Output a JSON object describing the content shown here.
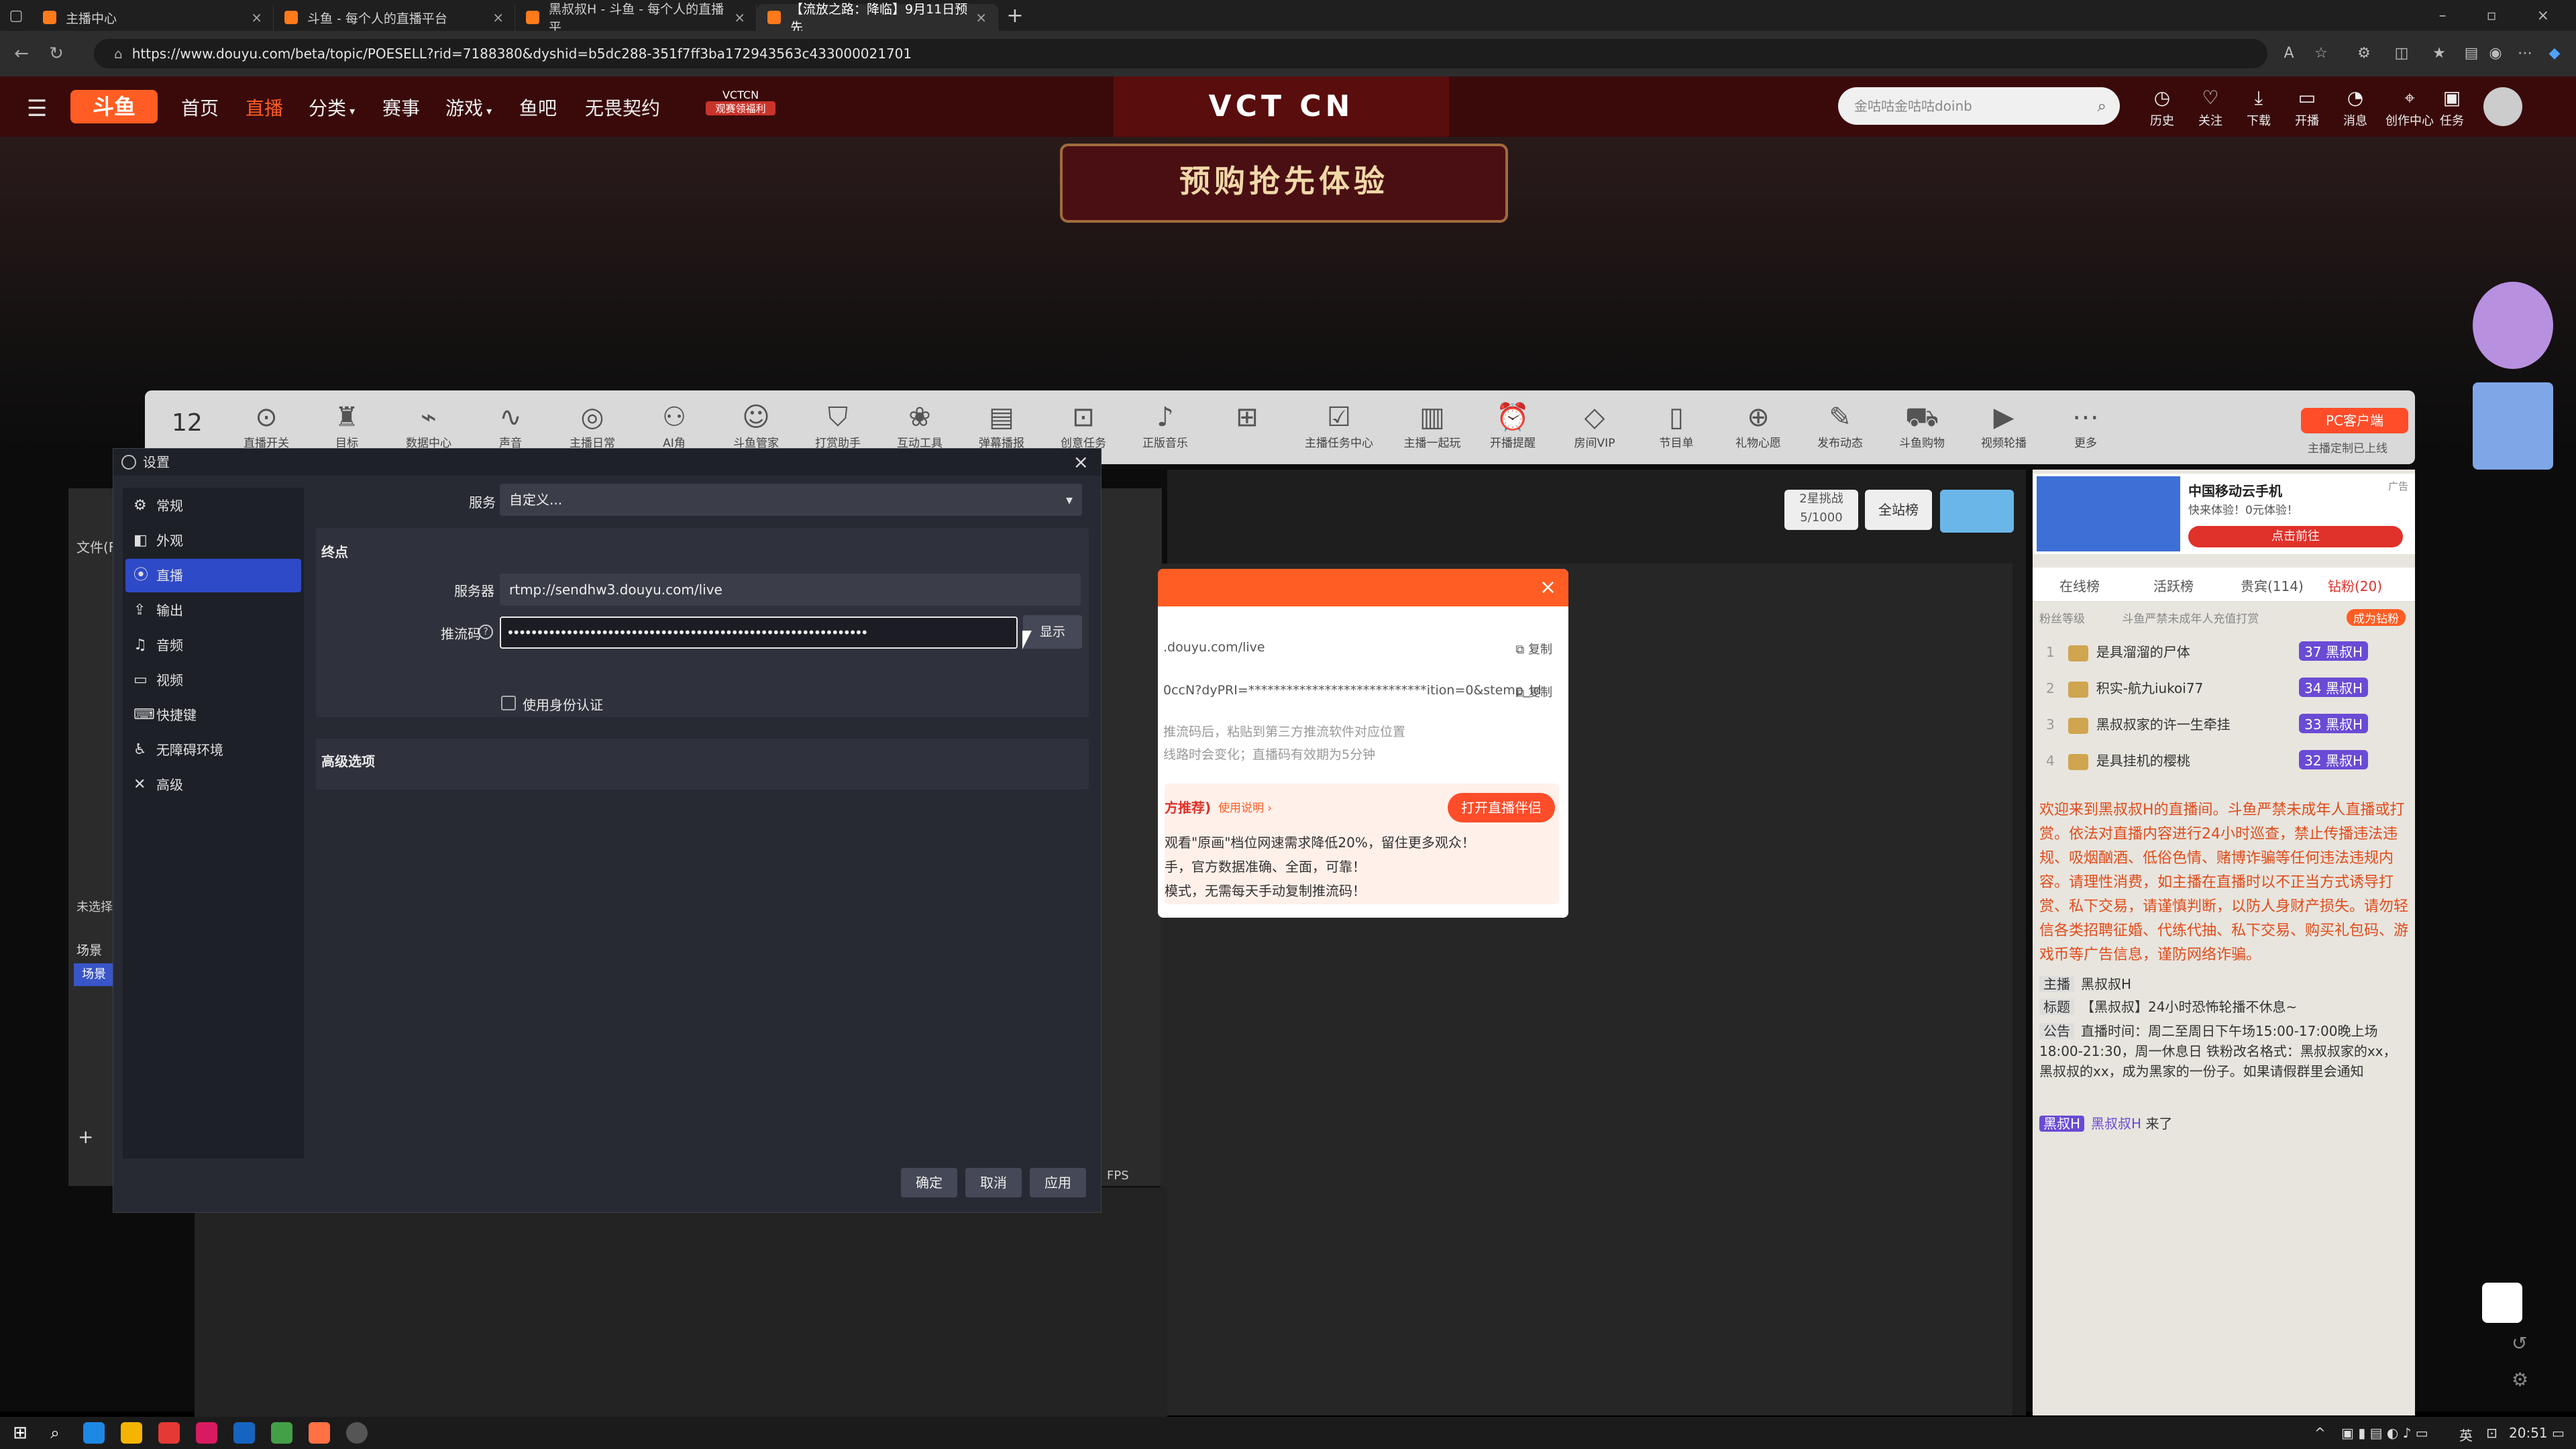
{
  "browser": {
    "tabs": [
      {
        "label": "主播中心"
      },
      {
        "label": "斗鱼 - 每个人的直播平台"
      },
      {
        "label": "黑叔叔H - 斗鱼 - 每个人的直播平"
      },
      {
        "label": "【流放之路：降临】9月11日预先"
      }
    ],
    "url": "https://www.douyu.com/beta/topic/POESELL?rid=7188380&dyshid=b5dc288-351f7ff3ba172943563c433000021701"
  },
  "site": {
    "logo": "斗鱼",
    "nav": [
      "首页",
      "直播",
      "分类",
      "赛事",
      "游戏",
      "鱼吧",
      "无畏契约"
    ],
    "vct_small": "VCTCN",
    "vct_sub": "观赛领福利",
    "vct_banner": "VCT CN",
    "search_placeholder": "金咕咕金咕咕doinb",
    "header_icons": [
      {
        "icon": "history-icon",
        "label": "历史"
      },
      {
        "icon": "heart-icon",
        "label": "关注"
      },
      {
        "icon": "download-icon",
        "label": "下载"
      },
      {
        "icon": "broadcast-icon",
        "label": "开播"
      },
      {
        "icon": "bell-icon",
        "label": "消息"
      },
      {
        "icon": "creator-icon",
        "label": "创作中心"
      },
      {
        "icon": "task-icon",
        "label": "任务"
      }
    ]
  },
  "hero": {
    "presale": "预购抢先体验"
  },
  "toolstrip": {
    "count": "12",
    "items": [
      "直播开关",
      "目标",
      "数据中心",
      "声音",
      "主播日常",
      "AI角",
      "斗鱼管家",
      "打赏助手",
      "互动工具",
      "弹幕播报",
      "创意任务",
      "正版音乐",
      "",
      "主播任务中心",
      "主播一起玩",
      "开播提醒",
      "房间VIP",
      "节目单",
      "礼物心愿",
      "发布动态",
      "斗鱼购物",
      "视频轮播",
      "更多"
    ],
    "pc_client": "PC客户端",
    "pc_client_sub": "主播定制已上线"
  },
  "room": {
    "challenge": "2星挑战",
    "challenge_progress": "5/1000",
    "all_station": "全站榜",
    "ad_title": "中国移动云手机",
    "ad_sub": "快来体验！0元体验！",
    "ad_btn": "点击前往",
    "ad_tag": "广告",
    "rank_tabs": [
      "在线榜",
      "活跃榜",
      "贵宾(114)",
      "钻粉(20)"
    ],
    "fan_level": "粉丝等级",
    "fan_note": "斗鱼严禁未成年人充值打赏",
    "fan_join": "成为钻粉",
    "rank_list": [
      {
        "rank": "1",
        "name": "是具溜溜的尸体",
        "level": "37",
        "badge": "黑叔H"
      },
      {
        "rank": "2",
        "name": "积实-航九iukoi77",
        "level": "34",
        "badge": "黑叔H"
      },
      {
        "rank": "3",
        "name": "黑叔叔家的许一生牵挂",
        "level": "33",
        "badge": "黑叔H"
      },
      {
        "rank": "4",
        "name": "是具挂机的樱桃",
        "level": "32",
        "badge": "黑叔H"
      }
    ],
    "welcome": "欢迎来到黑叔叔H的直播间。斗鱼严禁未成年人直播或打赏。依法对直播内容进行24小时巡查，禁止传播违法违规、吸烟酗酒、低俗色情、赌博诈骗等任何违法违规内容。请理性消费，如主播在直播时以不正当方式诱导打赏、私下交易，请谨慎判断，以防人身财产损失。请勿轻信各类招聘征婚、代练代抽、私下交易、购买礼包码、游戏币等广告信息，谨防网络诈骗。",
    "anchor_label": "主播",
    "anchor": "黑叔叔H",
    "title_label": "标题",
    "title": "【黑叔叔】24小时恐怖轮播不休息~",
    "notice_label": "公告",
    "notice": "直播时间：周二至周日下午场15:00-17:00晚上场18:00-21:30，周一休息日 铁粉改名格式：黑叔叔家的xx，黑叔叔的xx，成为黑家的一份子。如果请假群里会通知",
    "join_badge": "黑叔H",
    "join_name": "黑叔叔H",
    "join_text": "来了"
  },
  "dy_modal": {
    "server_url": ".douyu.com/live",
    "key_masked": "0ccN?dyPRI=****************************ition=0&stemp_id",
    "copy": "复制",
    "tip1": "推流码后，粘贴到第三方推流软件对应位置",
    "tip2": "线路时会变化；直播码有效期为5分钟",
    "recommend": "方推荐)",
    "howto": "使用说明 ›",
    "open_btn": "打开直播伴侣",
    "line1": "观看\"原画\"档位网速需求降低20%，留住更多观众！",
    "line2": "手，官方数据准确、全面，可靠！",
    "line3": "模式，无需每天手动复制推流码！"
  },
  "obs": {
    "title": "设置",
    "sidebar": [
      {
        "icon": "gear-icon",
        "label": "常规"
      },
      {
        "icon": "appearance-icon",
        "label": "外观"
      },
      {
        "icon": "stream-icon",
        "label": "直播"
      },
      {
        "icon": "output-icon",
        "label": "输出"
      },
      {
        "icon": "audio-icon",
        "label": "音频"
      },
      {
        "icon": "video-icon",
        "label": "视频"
      },
      {
        "icon": "keyboard-icon",
        "label": "快捷键"
      },
      {
        "icon": "accessibility-icon",
        "label": "无障碍环境"
      },
      {
        "icon": "tools-icon",
        "label": "高级"
      }
    ],
    "service_label": "服务",
    "service_value": "自定义...",
    "endpoint_label": "终点",
    "server_label": "服务器",
    "server_value": "rtmp://sendhw3.douyu.com/live",
    "key_label": "推流码",
    "key_value": "•••••••••••••••••••••••••••••••••••••••••••••••••••••••••••••",
    "show_btn": "显示",
    "auth_label": "使用身份认证",
    "advanced_label": "高级选项",
    "ok": "确定",
    "cancel": "取消",
    "apply": "应用",
    "bg_file": "文件(F)",
    "bg_unselected": "未选择",
    "bg_scene": "场景",
    "bg_fps": "FPS"
  },
  "taskbar": {
    "time": "20:51",
    "ime": "英"
  }
}
